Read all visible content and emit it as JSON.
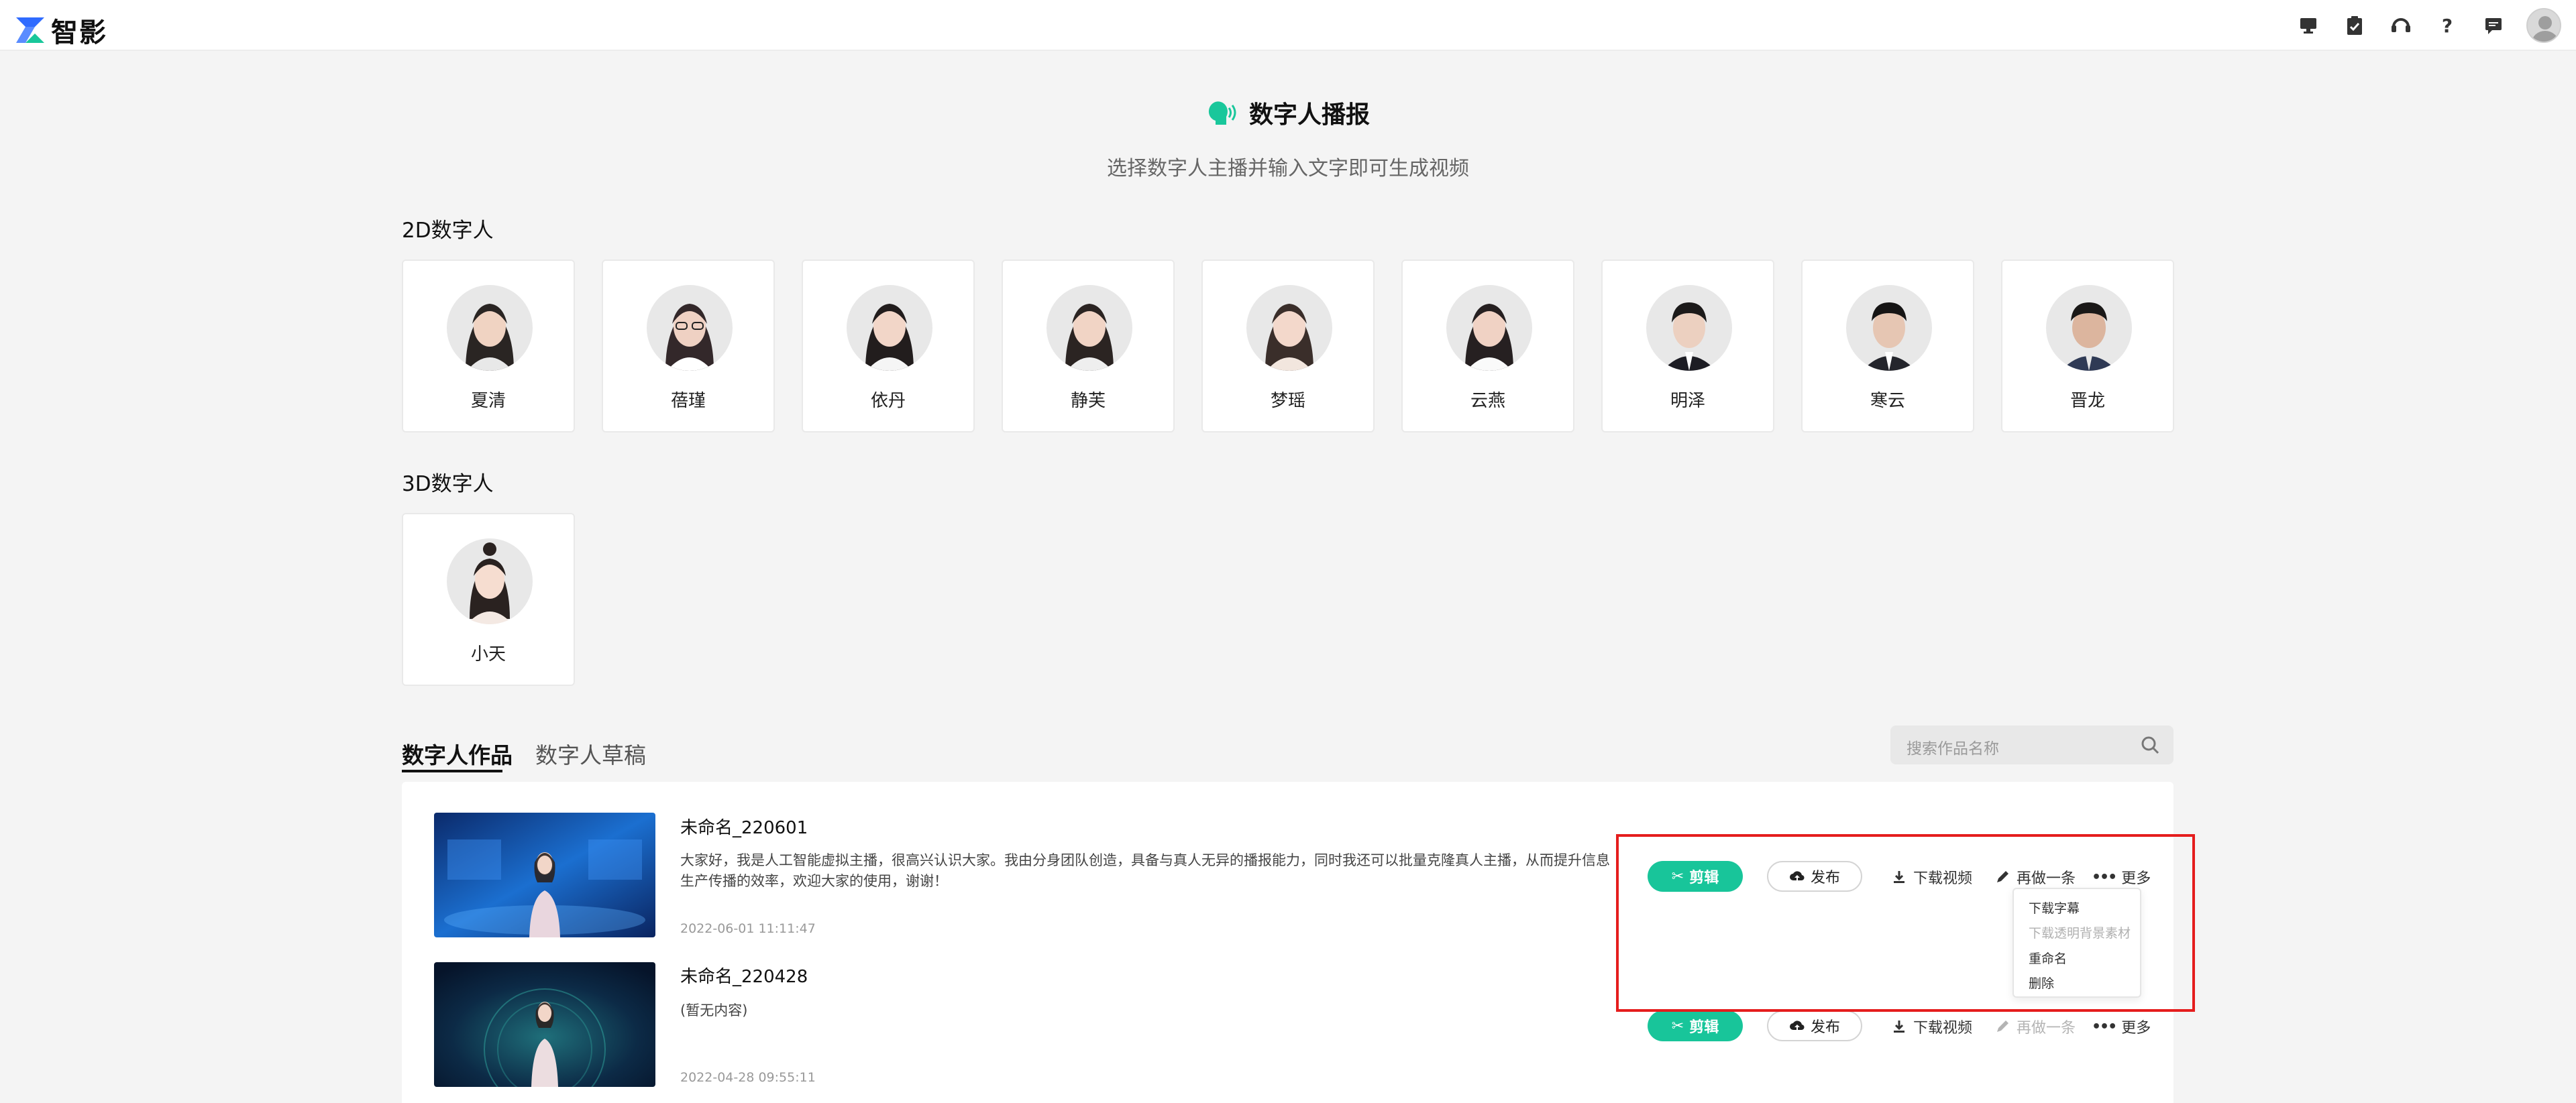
{
  "app": {
    "logo_text": "智影"
  },
  "topbar": {
    "icons": [
      "monitor-icon",
      "clipboard-check-icon",
      "headset-icon",
      "help-icon",
      "message-icon"
    ],
    "help_glyph": "?",
    "avatar": "user-avatar"
  },
  "header": {
    "title": "数字人播报",
    "subtitle": "选择数字人主播并输入文字即可生成视频"
  },
  "sections": {
    "d2_label": "2D数字人",
    "d3_label": "3D数字人"
  },
  "avatars_2d": [
    {
      "name": "夏清"
    },
    {
      "name": "蓓瑾"
    },
    {
      "name": "依丹"
    },
    {
      "name": "静芙"
    },
    {
      "name": "梦瑶"
    },
    {
      "name": "云燕"
    },
    {
      "name": "明泽"
    },
    {
      "name": "寒云"
    },
    {
      "name": "晋龙"
    }
  ],
  "avatars_3d": [
    {
      "name": "小天"
    }
  ],
  "tabs": [
    {
      "label": "数字人作品",
      "active": true
    },
    {
      "label": "数字人草稿",
      "active": false
    }
  ],
  "search": {
    "placeholder": "搜索作品名称"
  },
  "works": [
    {
      "title": "未命名_220601",
      "desc_line1": "大家好，我是人工智能虚拟主播，很高兴认识大家。我由分身团队创造，具备与真人无异的播报能力，同时我还可以批量克隆真人主播，从而提升信息",
      "desc_line2": "生产传播的效率，欢迎大家的使用，谢谢！",
      "time": "2022-06-01 11:11:47",
      "redo_enabled": true
    },
    {
      "title": "未命名_220428",
      "desc_line1": "(暂无内容)",
      "desc_line2": "",
      "time": "2022-04-28 09:55:11",
      "redo_enabled": false
    }
  ],
  "actions": {
    "edit": "剪辑",
    "publish": "发布",
    "download": "下载视频",
    "redo": "再做一条",
    "more": "更多"
  },
  "more_menu": [
    {
      "label": "下载字幕",
      "enabled": true
    },
    {
      "label": "下载透明背景素材",
      "enabled": false
    },
    {
      "label": "重命名",
      "enabled": true
    },
    {
      "label": "删除",
      "enabled": true
    }
  ],
  "colors": {
    "accent": "#18c59a",
    "highlight_box": "#e51d1d",
    "logo_blue": "#2f6bff",
    "logo_green": "#19c79b"
  }
}
